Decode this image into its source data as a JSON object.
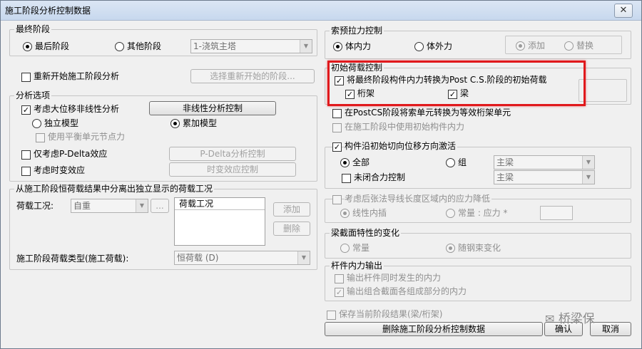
{
  "window": {
    "title": "施工阶段分析控制数据",
    "close_glyph": "✕"
  },
  "final_stage": {
    "group_label": "最终阶段",
    "last_stage_label": "最后阶段",
    "other_stage_label": "其他阶段",
    "stage_select_value": "1-浇筑主塔"
  },
  "restart": {
    "checkbox_label": "重新开始施工阶段分析",
    "select_button": "选择重新开始的阶段..."
  },
  "analysis_options": {
    "group_label": "分析选项",
    "large_disp_label": "考虑大位移非线性分析",
    "nonlinear_control_button": "非线性分析控制",
    "independent_model_label": "独立模型",
    "cumulative_model_label": "累加模型",
    "balance_node_force_label": "使用平衡单元节点力",
    "pdelta_label": "仅考虑P-Delta效应",
    "pdelta_control_button": "P-Delta分析控制",
    "time_dependent_label": "考虑时变效应",
    "time_dependent_button": "时变效应控制"
  },
  "separate_load": {
    "group_label": "从施工阶段恒荷载结果中分离出独立显示的荷载工况",
    "load_case_label": "荷载工况:",
    "load_case_value": "自重",
    "ellipsis": "...",
    "list_header": "荷载工况",
    "add_button": "添加",
    "delete_button": "删除",
    "type_label": "施工阶段荷载类型(施工荷载):",
    "type_value": "恒荷载  (D)"
  },
  "cable_pretension": {
    "group_label": "索预拉力控制",
    "internal_label": "体内力",
    "external_label": "体外力",
    "add_label": "添加",
    "replace_label": "替换"
  },
  "initial_load": {
    "group_label": "初始荷载控制",
    "convert_label": "将最终阶段构件内力转换为Post C.S.阶段的初始荷载",
    "truss_label": "桁架",
    "beam_label": "梁"
  },
  "postcs": {
    "convert_truss_label": "在PostCS阶段将索单元转换为等效桁架单元",
    "use_initial_force_label": "在施工阶段中使用初始构件内力"
  },
  "activation": {
    "checkbox_label": "构件沿初始切向位移方向激活",
    "all_label": "全部",
    "group_label_text": "组",
    "group_combo": "主梁",
    "unclosed_label": "未闭合力控制",
    "unclosed_combo": "主梁"
  },
  "post_tension": {
    "checkbox_label": "考虑后张法导线长度区域内的应力降低",
    "linear_label": "线性内插",
    "constant_label": "常量 : 应力 *"
  },
  "beam_section": {
    "group_label": "梁截面特性的变化",
    "constant_label": "常量",
    "age_label": "随钢束变化"
  },
  "member_force": {
    "group_label": "杆件内力输出",
    "simultaneous_label": "输出杆件同时发生的内力",
    "composite_label": "输出组合截面各组成部分的内力"
  },
  "footer": {
    "save_label": "保存当前阶段结果(梁/桁架)",
    "delete_button": "删除施工阶段分析控制数据",
    "ok_button": "确认",
    "cancel_button": "取消",
    "watermark": "桥梁保"
  }
}
